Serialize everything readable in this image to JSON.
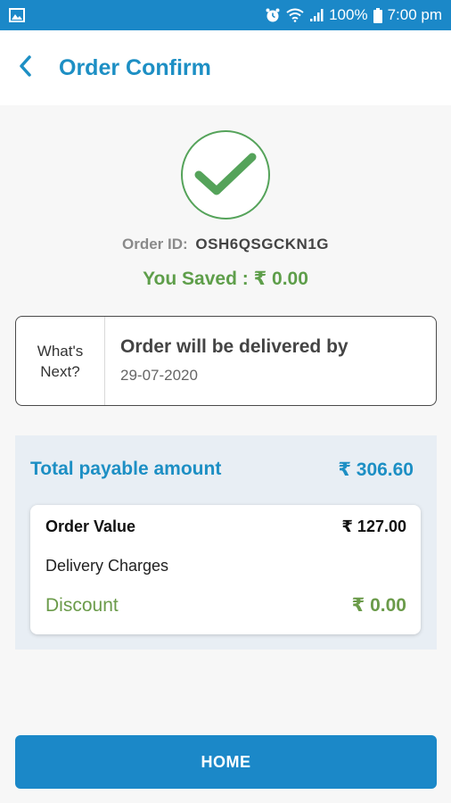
{
  "status_bar": {
    "battery": "100%",
    "time": "7:00 pm",
    "icons": [
      "image-icon",
      "alarm-icon",
      "wifi-icon",
      "signal-icon",
      "battery-icon"
    ]
  },
  "header": {
    "title": "Order Confirm",
    "back_icon": "chevron-left-icon"
  },
  "order": {
    "id_label": "Order ID:",
    "id_value": "OSH6QSGCKN1G",
    "saved_text": "You Saved : ₹ 0.00"
  },
  "whats_next": {
    "label_line1": "What's",
    "label_line2": "Next?",
    "title": "Order will be delivered by",
    "date": "29-07-2020"
  },
  "summary": {
    "total_label": "Total payable amount",
    "total_value": "₹ 306.60",
    "rows": [
      {
        "label": "Order Value",
        "value": "₹ 127.00"
      },
      {
        "label": "Delivery Charges",
        "value": ""
      },
      {
        "label": "Discount",
        "value": "₹ 0.00"
      }
    ]
  },
  "actions": {
    "home_label": "HOME"
  },
  "colors": {
    "primary": "#1b88c8",
    "title_blue": "#1d8fc4",
    "success_green": "#5e9e4a",
    "summary_bg": "#e8eef4"
  }
}
